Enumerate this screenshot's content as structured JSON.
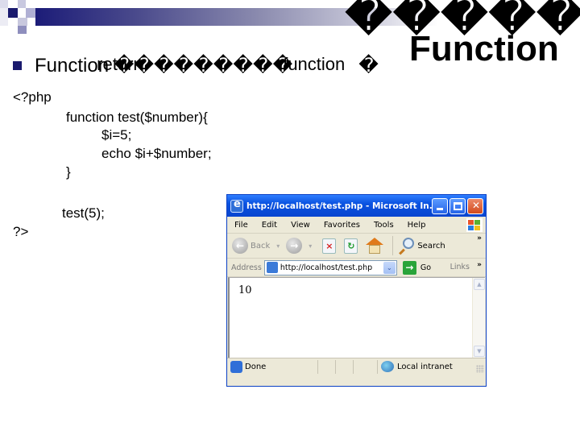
{
  "slide": {
    "title_top": "�����",
    "title_main": "Function",
    "bullet": {
      "prefix": "Function ����",
      "overlay_word": "return",
      "middle": " �����",
      "overlay_word2": "function",
      "suffix_glyph": "�"
    },
    "code": {
      "open_tag": "<?php",
      "function_decl": "function test($number){",
      "line_assign": "$i=5;",
      "line_echo": "echo $i+$number;",
      "close_brace": "}",
      "call": "test(5);",
      "close_tag": "?>"
    }
  },
  "browser": {
    "title": "http://localhost/test.php - Microsoft In...",
    "window_buttons": {
      "minimize": "minimize",
      "maximize": "maximize",
      "close": "✕"
    },
    "menu": [
      "File",
      "Edit",
      "View",
      "Favorites",
      "Tools",
      "Help"
    ],
    "toolbar": {
      "back_label": "Back",
      "back_glyph": "←",
      "forward_glyph": "→",
      "dropdown_glyph": "▾",
      "stop_glyph": "×",
      "refresh_glyph": "↻",
      "search_label": "Search",
      "more_glyph": "»"
    },
    "address": {
      "label": "Address",
      "value": "http://localhost/test.php",
      "dropdown_glyph": "⌄",
      "go_glyph": "→",
      "go_label": "Go",
      "links_label": "Links",
      "more_glyph": "»"
    },
    "content": {
      "output": "10",
      "scroll_up": "▲",
      "scroll_down": "▼"
    },
    "status": {
      "text": "Done",
      "zone": "Local intranet"
    }
  }
}
